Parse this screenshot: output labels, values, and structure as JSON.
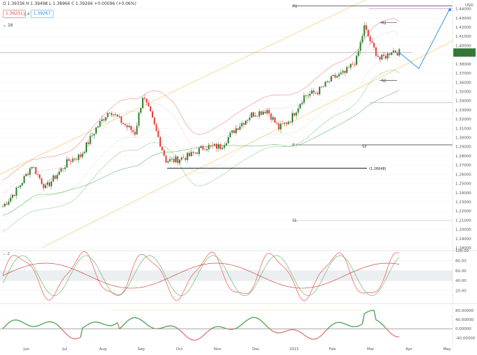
{
  "header": {
    "symbol_info": "O 1.39336  H 1.39498  L 1.38966  C 1.39266  +0.00096 (+0.06%)",
    "price_red": "1.39231",
    "spread": "1.4",
    "price_blue": "1.39267",
    "indicator_label": "16"
  },
  "price_axis": {
    "currency": "USD",
    "ticks": [
      "1.44000",
      "1.43000",
      "1.42000",
      "1.41000",
      "1.40000",
      "1.39000",
      "1.38000",
      "1.37000",
      "1.36000",
      "1.35000",
      "1.34000",
      "1.33000",
      "1.32000",
      "1.31000",
      "1.30000",
      "1.29000",
      "1.28000",
      "1.27000",
      "1.26000",
      "1.25000",
      "1.24000",
      "1.23000",
      "1.22000",
      "1.21000",
      "1.20000",
      "1.19000",
      "1.18000"
    ],
    "current_price": "1.39242",
    "current_sub": "11:49:30"
  },
  "levels": {
    "r1": "R1",
    "r2": "R2",
    "s2": "S2",
    "p": "P",
    "s3": "S3",
    "s1": "S1",
    "low_label": "(1.26648)"
  },
  "stoch_panel": {
    "label": "2",
    "ticks": [
      "100.00",
      "80.00",
      "60.00",
      "40.00",
      "20.00"
    ]
  },
  "momentum_panel": {
    "ticks": [
      "80.00000",
      "40.00000",
      "0.00000",
      "-40.00000"
    ]
  },
  "x_axis": [
    "Jun",
    "Jul",
    "Aug",
    "Sep",
    "Oct",
    "Nov",
    "Dec",
    "2021",
    "Feb",
    "Mar",
    "Apr",
    "May"
  ],
  "colors": {
    "up": "#2e7d32",
    "down": "#e53935",
    "bb": "#ef9a9a",
    "ma": "#a5d6a7",
    "channel": "#ffcc80",
    "proj": "#1e88e5"
  },
  "chart_data": {
    "type": "candlestick",
    "ylim": [
      1.18,
      1.445
    ],
    "bars_count": 205,
    "close_path": [
      [
        0,
        1.225
      ],
      [
        8,
        1.245
      ],
      [
        15,
        1.27
      ],
      [
        22,
        1.245
      ],
      [
        28,
        1.26
      ],
      [
        34,
        1.275
      ],
      [
        40,
        1.28
      ],
      [
        48,
        1.31
      ],
      [
        55,
        1.33
      ],
      [
        62,
        1.315
      ],
      [
        68,
        1.305
      ],
      [
        72,
        1.345
      ],
      [
        76,
        1.325
      ],
      [
        80,
        1.3
      ],
      [
        84,
        1.275
      ],
      [
        88,
        1.275
      ],
      [
        96,
        1.28
      ],
      [
        104,
        1.29
      ],
      [
        112,
        1.29
      ],
      [
        120,
        1.31
      ],
      [
        128,
        1.325
      ],
      [
        136,
        1.33
      ],
      [
        142,
        1.31
      ],
      [
        148,
        1.32
      ],
      [
        155,
        1.345
      ],
      [
        162,
        1.35
      ],
      [
        170,
        1.365
      ],
      [
        176,
        1.37
      ],
      [
        182,
        1.385
      ],
      [
        186,
        1.42
      ],
      [
        190,
        1.4
      ],
      [
        194,
        1.385
      ],
      [
        198,
        1.39
      ],
      [
        200,
        1.395
      ],
      [
        204,
        1.3924
      ]
    ],
    "projection": [
      [
        204,
        1.3924
      ],
      [
        214,
        1.375
      ],
      [
        230,
        1.44
      ]
    ],
    "pivots": {
      "R1": 1.443,
      "R2": 1.425,
      "S2": 1.362,
      "P": 1.292,
      "S3": 1.292,
      "S1": 1.21,
      "low": 1.2665
    }
  }
}
